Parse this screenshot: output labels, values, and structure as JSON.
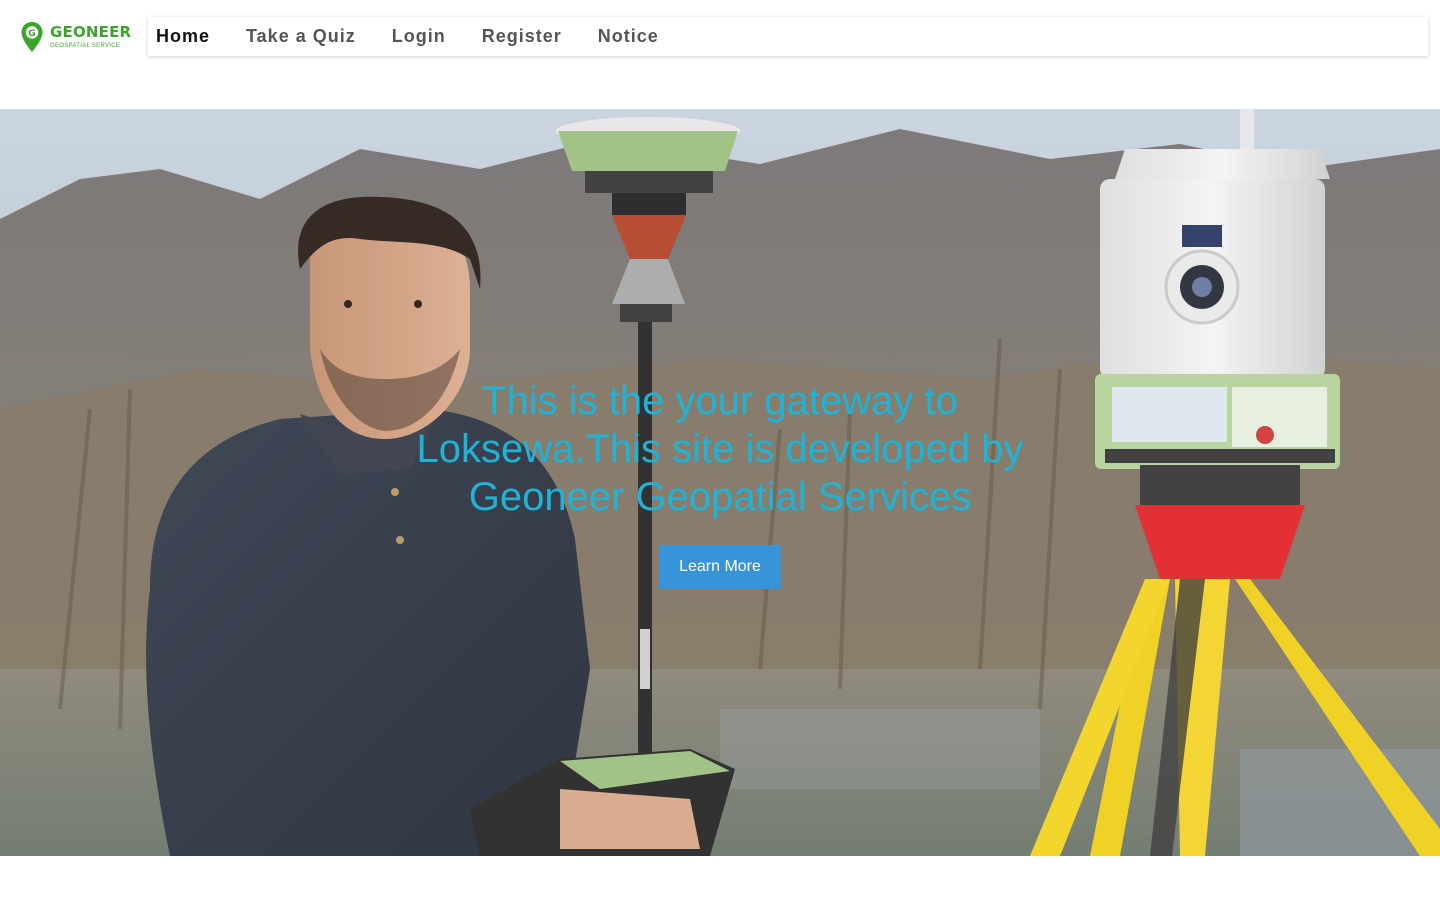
{
  "logo": {
    "name": "GEONEER",
    "subtitle": "GEOSPATIAL SERVICE",
    "brand_color": "#3aa52a"
  },
  "nav": {
    "items": [
      {
        "label": "Home",
        "active": true
      },
      {
        "label": "Take a Quiz",
        "active": false
      },
      {
        "label": "Login",
        "active": false
      },
      {
        "label": "Register",
        "active": false
      },
      {
        "label": "Notice",
        "active": false
      }
    ]
  },
  "hero": {
    "title": "This is the your gateway to Loksewa.This site is developed by Geoneer Geopatial Services",
    "button_label": "Learn More",
    "title_color": "#1fb4d6",
    "button_color": "#3794d8"
  }
}
